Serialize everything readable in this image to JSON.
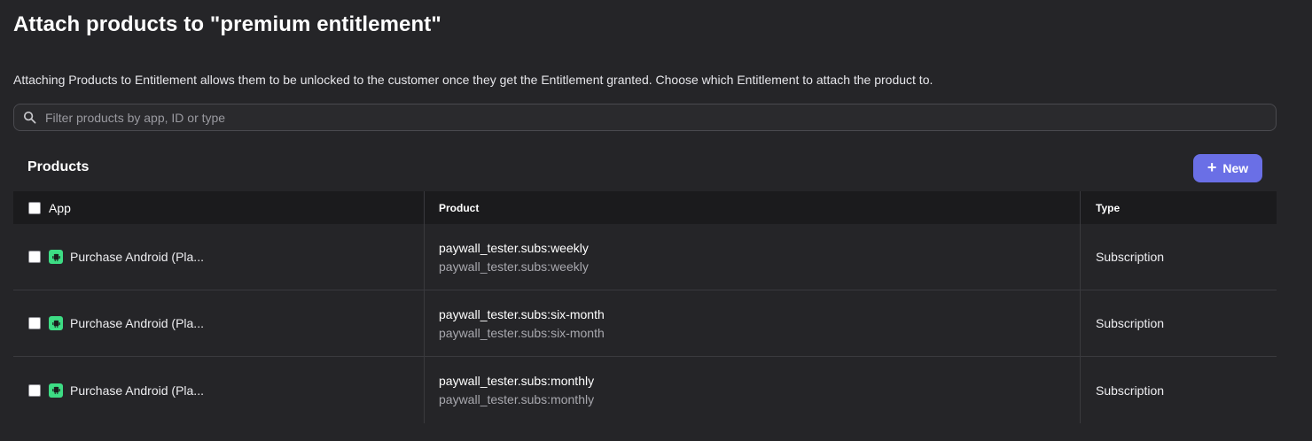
{
  "page": {
    "title": "Attach products to \"premium entitlement\"",
    "description": "Attaching Products to Entitlement allows them to be unlocked to the customer once they get the Entitlement granted. Choose which Entitlement to attach the product to."
  },
  "search": {
    "placeholder": "Filter products by app, ID or type",
    "value": "",
    "icon": "search-icon"
  },
  "products": {
    "section_title": "Products",
    "new_button_label": "New",
    "new_button_color": "#6a6fe6"
  },
  "table": {
    "headers": {
      "app": "App",
      "product": "Product",
      "type": "Type"
    },
    "rows": [
      {
        "app": "Purchase Android (Pla...",
        "app_icon": "android-icon",
        "product_name": "paywall_tester.subs:weekly",
        "product_id": "paywall_tester.subs:weekly",
        "type": "Subscription"
      },
      {
        "app": "Purchase Android (Pla...",
        "app_icon": "android-icon",
        "product_name": "paywall_tester.subs:six-month",
        "product_id": "paywall_tester.subs:six-month",
        "type": "Subscription"
      },
      {
        "app": "Purchase Android (Pla...",
        "app_icon": "android-icon",
        "product_name": "paywall_tester.subs:monthly",
        "product_id": "paywall_tester.subs:monthly",
        "type": "Subscription"
      }
    ]
  },
  "colors": {
    "background": "#252528",
    "header_background": "#1b1b1d",
    "android_green": "#3ddc84"
  }
}
